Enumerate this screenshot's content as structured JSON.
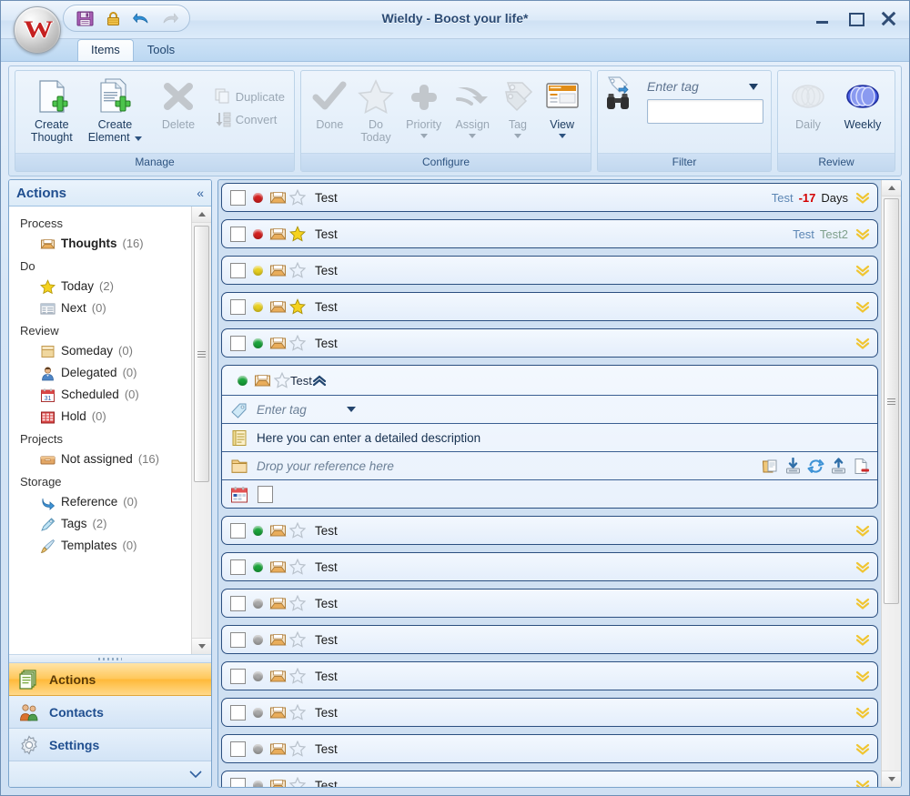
{
  "window": {
    "title": "Wieldy - Boost your life*",
    "minimize_label": "Minimize",
    "maximize_label": "Maximize",
    "close_label": "Close",
    "app_orb_letter": "W"
  },
  "quick_access": [
    {
      "name": "save-icon",
      "label": "Save",
      "enabled": true
    },
    {
      "name": "lock-icon",
      "label": "Lock",
      "enabled": true
    },
    {
      "name": "undo-icon",
      "label": "Undo",
      "enabled": true
    },
    {
      "name": "redo-icon",
      "label": "Redo",
      "enabled": false
    }
  ],
  "tabs": [
    {
      "label": "Items",
      "active": true
    },
    {
      "label": "Tools",
      "active": false
    }
  ],
  "ribbon": {
    "groups": [
      {
        "label": "Manage",
        "big_buttons": [
          {
            "label_line1": "Create",
            "label_line2": "Thought",
            "icon": "new-thought-icon",
            "enabled": true,
            "has_caret": false
          },
          {
            "label_line1": "Create",
            "label_line2": "Element",
            "icon": "new-element-icon",
            "enabled": true,
            "has_caret": true
          }
        ],
        "extra_big": [
          {
            "label_line1": "Delete",
            "label_line2": "",
            "icon": "delete-x-icon",
            "enabled": false,
            "has_caret": false
          }
        ],
        "small_buttons": [
          {
            "label": "Duplicate",
            "icon": "duplicate-icon",
            "enabled": false
          },
          {
            "label": "Convert",
            "icon": "convert-icon",
            "enabled": false
          }
        ]
      },
      {
        "label": "Configure",
        "big_buttons": [
          {
            "label_line1": "Done",
            "label_line2": "",
            "icon": "check-icon",
            "enabled": false,
            "has_caret": false
          },
          {
            "label_line1": "Do",
            "label_line2": "Today",
            "icon": "star-icon",
            "enabled": false,
            "has_caret": false
          },
          {
            "label_line1": "Priority",
            "label_line2": "",
            "icon": "priority-plus-icon",
            "enabled": false,
            "has_caret": true
          },
          {
            "label_line1": "Assign",
            "label_line2": "",
            "icon": "assign-arrow-icon",
            "enabled": false,
            "has_caret": true
          },
          {
            "label_line1": "Tag",
            "label_line2": "",
            "icon": "tag-icon",
            "enabled": false,
            "has_caret": true
          },
          {
            "label_line1": "View",
            "label_line2": "",
            "icon": "view-window-icon",
            "enabled": true,
            "has_caret": true
          }
        ]
      },
      {
        "label": "Filter",
        "tag_placeholder": "Enter tag",
        "tag_value": "",
        "search_icon": "binoculars-icon",
        "tag_icon": "tag-filter-icon"
      },
      {
        "label": "Review",
        "big_buttons": [
          {
            "label_line1": "Daily",
            "label_line2": "",
            "icon": "daily-circles-icon",
            "enabled": false,
            "has_caret": false
          },
          {
            "label_line1": "Weekly",
            "label_line2": "",
            "icon": "weekly-circles-icon",
            "enabled": true,
            "has_caret": false
          }
        ]
      }
    ]
  },
  "sidebar": {
    "title": "Actions",
    "collapse_label": "«",
    "sections": [
      {
        "heading": "Process",
        "items": [
          {
            "label": "Thoughts",
            "count": "(16)",
            "icon": "inbox-icon",
            "bold": true
          }
        ]
      },
      {
        "heading": "Do",
        "items": [
          {
            "label": "Today",
            "count": "(2)",
            "icon": "star-icon",
            "bold": false
          },
          {
            "label": "Next",
            "count": "(0)",
            "icon": "list-icon",
            "bold": false
          }
        ]
      },
      {
        "heading": "Review",
        "items": [
          {
            "label": "Someday",
            "count": "(0)",
            "icon": "envelope-icon",
            "bold": false
          },
          {
            "label": "Delegated",
            "count": "(0)",
            "icon": "person-icon",
            "bold": false
          },
          {
            "label": "Scheduled",
            "count": "(0)",
            "icon": "calendar-icon",
            "bold": false
          },
          {
            "label": "Hold",
            "count": "(0)",
            "icon": "hold-icon",
            "bold": false
          }
        ]
      },
      {
        "heading": "Projects",
        "items": [
          {
            "label": "Not assigned",
            "count": "(16)",
            "icon": "box-icon",
            "bold": false
          }
        ]
      },
      {
        "heading": "Storage",
        "items": [
          {
            "label": "Reference",
            "count": "(0)",
            "icon": "arrow-ref-icon",
            "bold": false
          },
          {
            "label": "Tags",
            "count": "(2)",
            "icon": "pencil-tag-icon",
            "bold": false
          },
          {
            "label": "Templates",
            "count": "(0)",
            "icon": "brush-icon",
            "bold": false
          }
        ]
      }
    ],
    "nav_buttons": [
      {
        "label": "Actions",
        "icon": "stack-icon",
        "selected": true
      },
      {
        "label": "Contacts",
        "icon": "contacts-icon",
        "selected": false
      },
      {
        "label": "Settings",
        "icon": "gear-icon",
        "selected": false
      }
    ]
  },
  "list": {
    "rows": [
      {
        "title": "Test",
        "dot": "red",
        "starred": false,
        "meta": [
          {
            "text": "Test",
            "kind": "tag"
          },
          {
            "text": "-17",
            "kind": "neg"
          },
          {
            "text": "Days",
            "kind": "day"
          }
        ],
        "expanded": false
      },
      {
        "title": "Test",
        "dot": "red",
        "starred": true,
        "meta": [
          {
            "text": "Test",
            "kind": "tag"
          },
          {
            "text": "Test2",
            "kind": "tag2"
          }
        ],
        "expanded": false
      },
      {
        "title": "Test",
        "dot": "yellow",
        "starred": false,
        "meta": [],
        "expanded": false
      },
      {
        "title": "Test",
        "dot": "yellow",
        "starred": true,
        "meta": [],
        "expanded": false
      },
      {
        "title": "Test",
        "dot": "green",
        "starred": false,
        "meta": [],
        "expanded": false
      },
      {
        "title": "Test",
        "dot": "green",
        "starred": false,
        "meta": [],
        "expanded": true
      },
      {
        "title": "Test",
        "dot": "green",
        "starred": false,
        "meta": [],
        "expanded": false
      },
      {
        "title": "Test",
        "dot": "green",
        "starred": false,
        "meta": [],
        "expanded": false
      },
      {
        "title": "Test",
        "dot": "gray",
        "starred": false,
        "meta": [],
        "expanded": false
      },
      {
        "title": "Test",
        "dot": "gray",
        "starred": false,
        "meta": [],
        "expanded": false
      },
      {
        "title": "Test",
        "dot": "gray",
        "starred": false,
        "meta": [],
        "expanded": false
      },
      {
        "title": "Test",
        "dot": "gray",
        "starred": false,
        "meta": [],
        "expanded": false
      },
      {
        "title": "Test",
        "dot": "gray",
        "starred": false,
        "meta": [],
        "expanded": false
      },
      {
        "title": "Test",
        "dot": "gray",
        "starred": false,
        "meta": [],
        "expanded": false
      }
    ],
    "expanded_detail": {
      "tag_placeholder": "Enter tag",
      "description_placeholder": "Here you can enter a detailed description",
      "reference_placeholder": "Drop your reference here",
      "reference_icons": [
        {
          "name": "open-folder-icon"
        },
        {
          "name": "download-icon"
        },
        {
          "name": "sync-icon"
        },
        {
          "name": "upload-icon"
        },
        {
          "name": "delete-file-icon"
        }
      ]
    }
  },
  "colors": {
    "dot_red": "#d31f1f",
    "dot_yellow": "#e8d01f",
    "dot_green": "#1aa33a",
    "dot_gray": "#a8a8a8",
    "accent_orange": "#ffc85c",
    "title_blue": "#2b4a73",
    "link_blue": "#5c86b4",
    "negative_red": "#d40000"
  }
}
